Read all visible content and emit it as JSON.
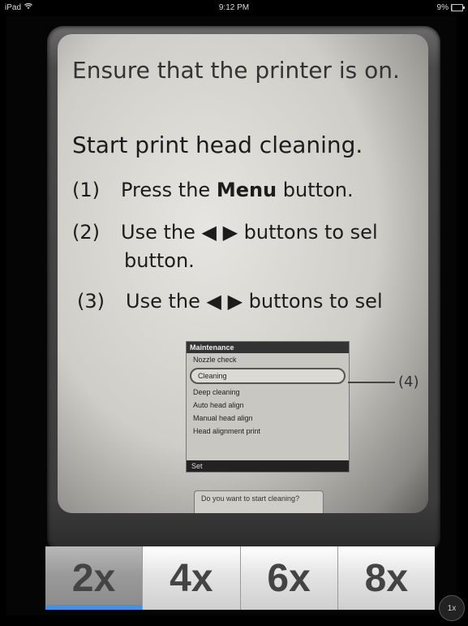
{
  "status_bar": {
    "device": "iPad",
    "wifi_icon": "wifi-icon",
    "time": "9:12 PM",
    "battery_percent": "9%",
    "battery_level": 0.09,
    "battery_color": "#d33"
  },
  "document": {
    "line1": "Ensure that the printer is on.",
    "line2": "Start print head cleaning.",
    "step1_num": "(1)",
    "step1_pre": "Press the ",
    "step1_bold": "Menu",
    "step1_post": " button.",
    "step2_num": "(2)",
    "step2_text": "Use the ◀ ▶ buttons to sel",
    "step2_cont": "button.",
    "step3_num": "(3)",
    "step3_text": "Use the ◀ ▶ buttons to sel",
    "lcd": {
      "title": "Maintenance",
      "items": [
        "Nozzle check",
        "Cleaning",
        "Deep cleaning",
        "Auto head align",
        "Manual head align",
        "Head alignment print"
      ],
      "selected_index": 1,
      "footer": "Set"
    },
    "callout": "(4)",
    "prompt": "Do you want to start cleaning?"
  },
  "zoom_options": [
    "2x",
    "4x",
    "6x",
    "8x"
  ],
  "active_zoom_index": 0,
  "accent_color": "#4a90e2",
  "corner_zoom": "1x"
}
